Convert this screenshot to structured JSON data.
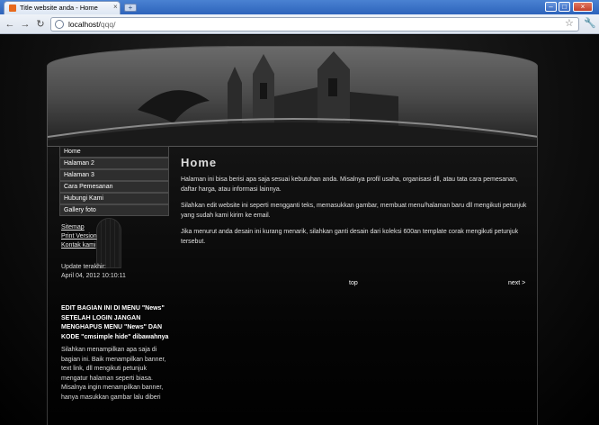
{
  "browser": {
    "tab_title": "Title website anda - Home",
    "tab_close": "×",
    "new_tab": "+",
    "url_host": "localhost/",
    "url_path": "qqq/",
    "back": "←",
    "forward": "→",
    "reload": "↻",
    "star": "☆",
    "wrench": "🔧",
    "win_min": "–",
    "win_max": "□",
    "win_close": "×"
  },
  "sidebar": {
    "menu": [
      {
        "label": "Home"
      },
      {
        "label": "Halaman 2"
      },
      {
        "label": "Halaman 3"
      },
      {
        "label": "Cara Pemesanan"
      },
      {
        "label": "Hubungi Kami"
      },
      {
        "label": "Gallery foto"
      }
    ],
    "links": [
      {
        "label": "Sitemap"
      },
      {
        "label": "Print Version"
      },
      {
        "label": "Kontak kami"
      }
    ],
    "update_label": "Update terakhir:",
    "update_date": "April 04, 2012 10:10:11",
    "news_title": "EDIT BAGIAN INI DI MENU \"News\" SETELAH LOGIN JANGAN MENGHAPUS MENU \"News\" DAN KODE \"cmsimple hide\" dibawahnya",
    "news_body": "Silahkan menampilkan apa saja di bagian ini. Baik menampilkan banner, text link, dll mengikuti petunjuk mengatur halaman seperti biasa. Misalnya ingin menampilkan banner, hanya masukkan gambar lalu diberi"
  },
  "main": {
    "title": "Home",
    "paragraphs": [
      "Halaman ini bisa berisi apa saja sesuai kebutuhan anda. Misalnya profil usaha, organisasi dll, atau tata cara pemesanan, daftar harga, atau informasi lainnya.",
      "Silahkan edit website ini seperti mengganti teks, memasukkan gambar, membuat menu/halaman baru dll mengikuti petunjuk yang sudah kami kirim ke email.",
      "Jika menurut anda desain ini kurang menarik, silahkan ganti desain dari koleksi 600an template corak mengikuti petunjuk tersebut."
    ],
    "top_link": "top",
    "next_link": "next >"
  },
  "colors": {
    "titlebar": "#2d63bb",
    "page_bg": "#000000",
    "menu_bg": "#2e2e2e",
    "text": "#e0e0e0"
  }
}
